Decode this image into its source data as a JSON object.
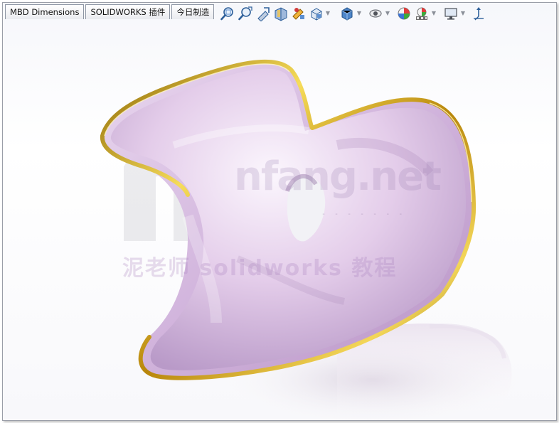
{
  "tabs": [
    {
      "label": "MBD Dimensions"
    },
    {
      "label": "SOLIDWORKS 插件"
    },
    {
      "label": "今日制造"
    }
  ],
  "toolbar": {
    "icons": [
      "zoom-to-fit-icon",
      "zoom-to-area-icon",
      "previous-view-icon",
      "section-view-icon",
      "dynamic-annotation-views-icon",
      "view-orientation-icon",
      "display-style-icon",
      "hide-show-items-icon",
      "edit-appearance-icon",
      "apply-scene-icon",
      "view-settings-icon",
      "triad-icon"
    ]
  },
  "watermark": {
    "site_text": "nfang.net",
    "dashes": "- - - - - - -",
    "caption": "泥老师 solidworks 教程"
  },
  "colors": {
    "body": "#d9c2e3",
    "trim": "#d4ac1a",
    "background": "#f6f7fb"
  }
}
